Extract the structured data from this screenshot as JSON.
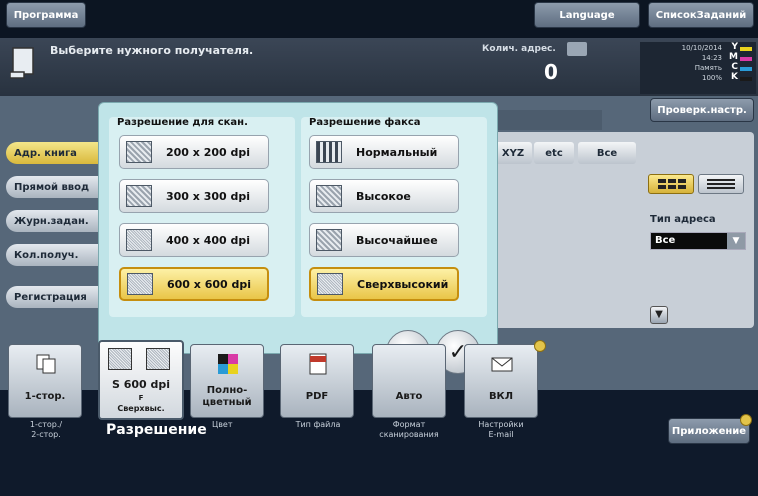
{
  "topbar": {
    "program": "Программа",
    "language": "Language",
    "job_list": "СписокЗаданий"
  },
  "message": {
    "text": "Выберите нужного получателя.",
    "count_label": "Колич. адрес.",
    "count_value": "0",
    "date": "10/10/2014",
    "time": "14:23",
    "memory_label": "Память",
    "memory_value": "100%",
    "toner_labels": [
      "Y",
      "M",
      "C",
      "K"
    ],
    "toner_colors": [
      "#e8d21e",
      "#d83aa6",
      "#2a9bd6",
      "#1a1a1a"
    ]
  },
  "check_settings": "Проверк.настр.",
  "sidebar": {
    "items": [
      {
        "label": "Адр. книга"
      },
      {
        "label": "Прямой ввод"
      },
      {
        "label": "Журн.задан."
      },
      {
        "label": "Кол.получ."
      },
      {
        "label": "Регистрация"
      }
    ]
  },
  "alphabet": [
    "XYZ",
    "etc",
    "Все"
  ],
  "address_type": {
    "label": "Тип адреса",
    "value": "Все"
  },
  "dialog": {
    "scan_title": "Разрешение для скан.",
    "scan_options": [
      "200 x 200 dpi",
      "300 x 300 dpi",
      "400 x 400 dpi",
      "600 x 600 dpi"
    ],
    "scan_selected": "600 x 600 dpi",
    "fax_title": "Разрешение факса",
    "fax_options": [
      "Нормальный",
      "Высокое",
      "Высочайшее",
      "Сверхвысокий"
    ],
    "fax_selected": "Сверхвысокий",
    "cancel_icon": "close-icon",
    "ok_icon": "check-icon"
  },
  "tiles": [
    {
      "label": "1-стор.",
      "caption": "1-стор./\n2-стор."
    },
    {
      "label": "S 600 dpi",
      "sublabel": "F",
      "sublabel2": "Сверхвыс.",
      "caption": "Разрешение"
    },
    {
      "label": "Полно-\nцветный",
      "caption": "Цвет"
    },
    {
      "label": "PDF",
      "caption": "Тип файла"
    },
    {
      "label": "Авто",
      "caption": "Формат\nсканирования"
    },
    {
      "label": "ВКЛ",
      "caption": "Настройки\nE-mail"
    }
  ],
  "application": "Приложение"
}
